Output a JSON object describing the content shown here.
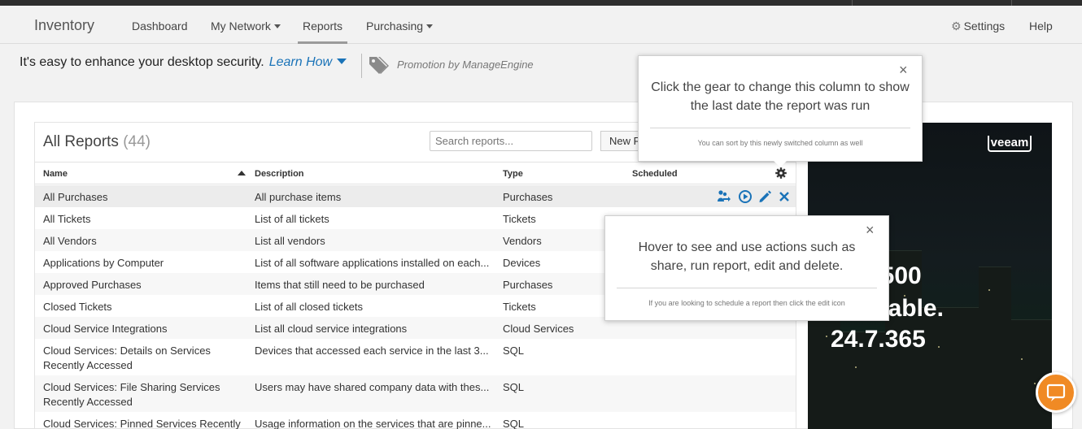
{
  "nav": {
    "brand": "Inventory",
    "items": [
      {
        "label": "Dashboard"
      },
      {
        "label": "My Network"
      },
      {
        "label": "Reports"
      },
      {
        "label": "Purchasing"
      }
    ],
    "settings": "Settings",
    "help": "Help"
  },
  "promo": {
    "text": "It's easy to enhance your desktop security.",
    "link": "Learn How",
    "by": "Promotion by ManageEngine"
  },
  "reports": {
    "title": "All Reports",
    "count": "(44)",
    "search_placeholder": "Search reports...",
    "new_button": "New Report",
    "columns": {
      "name": "Name",
      "description": "Description",
      "type": "Type",
      "scheduled": "Scheduled"
    },
    "rows": [
      {
        "name": "All Purchases",
        "description": "All purchase items",
        "type": "Purchases"
      },
      {
        "name": "All Tickets",
        "description": "List of all tickets",
        "type": "Tickets"
      },
      {
        "name": "All Vendors",
        "description": "List all vendors",
        "type": "Vendors"
      },
      {
        "name": "Applications by Computer",
        "description": "List of all software applications installed on each...",
        "type": "Devices"
      },
      {
        "name": "Approved Purchases",
        "description": "Items that still need to be purchased",
        "type": "Purchases"
      },
      {
        "name": "Closed Tickets",
        "description": "List of all closed tickets",
        "type": "Tickets"
      },
      {
        "name": "Cloud Service Integrations",
        "description": "List all cloud service integrations",
        "type": "Cloud Services"
      },
      {
        "name": "Cloud Services: Details on Services Recently Accessed",
        "description": "Devices that accessed each service in the last 3...",
        "type": "SQL"
      },
      {
        "name": "Cloud Services: File Sharing Services Recently Accessed",
        "description": "Users may have shared company data with thes...",
        "type": "SQL"
      },
      {
        "name": "Cloud Services: Pinned Services Recently",
        "description": "Usage information on the services that are pinne...",
        "type": "SQL"
      }
    ]
  },
  "tooltips": {
    "gear": {
      "close": "×",
      "main": "Click the gear to change this column to show the last date the report was run",
      "sub": "You can sort by this newly switched column as well"
    },
    "actions": {
      "close": "×",
      "main": "Hover to see and use actions such as share, run report, edit and delete.",
      "sub": "If you are looking to schedule a report then click the edit icon"
    }
  },
  "ad": {
    "logo": "veeam",
    "line1": "une 500",
    "line2": "Available.",
    "line3": "24.7.365"
  },
  "icons": {
    "settings": "gear-icon",
    "promo": "tag-icon",
    "column_settings": "gear-icon",
    "share": "share-icon",
    "run": "play-circle-icon",
    "edit": "pencil-icon",
    "delete": "close-icon",
    "chat": "chat-bubble-icon"
  },
  "colors": {
    "link": "#1a73b8",
    "action_icons": "#1a73b8",
    "chat_button": "#f08a24"
  }
}
